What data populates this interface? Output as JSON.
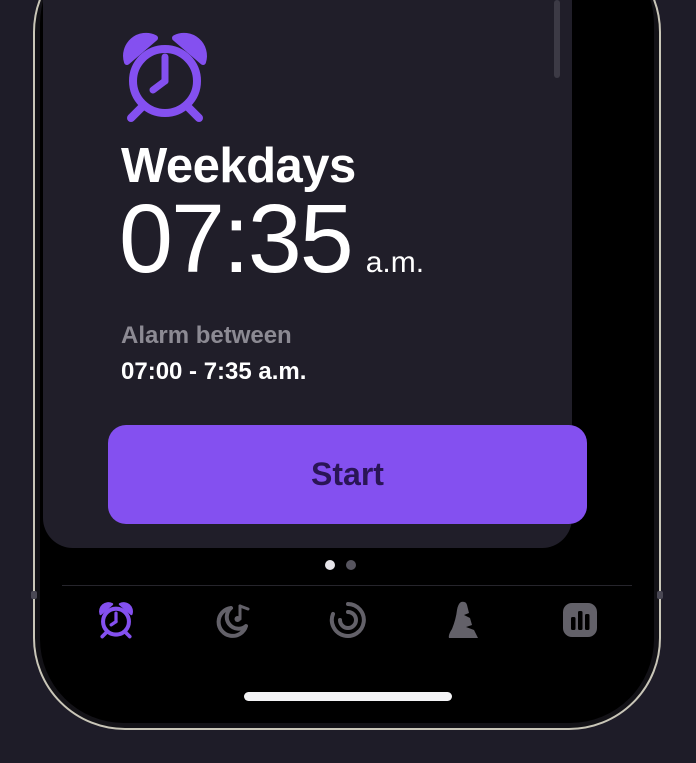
{
  "alarm": {
    "title": "Weekdays",
    "time": "07:35",
    "period": "a.m.",
    "window_label": "Alarm between",
    "window_range": "07:00 - 7:35 a.m."
  },
  "start_button_label": "Start",
  "pager": {
    "pages": 2,
    "current": 1
  },
  "tabbar": {
    "tabs": [
      {
        "icon": "alarm-clock-icon",
        "active": true
      },
      {
        "icon": "moon-note-icon",
        "active": false
      },
      {
        "icon": "sleep-cycle-icon",
        "active": false
      },
      {
        "icon": "sleep-aid-icon",
        "active": false
      },
      {
        "icon": "statistics-icon",
        "active": false
      }
    ]
  },
  "colors": {
    "accent": "#8450f0",
    "card": "#201e29",
    "inactive_icon": "#636169"
  }
}
